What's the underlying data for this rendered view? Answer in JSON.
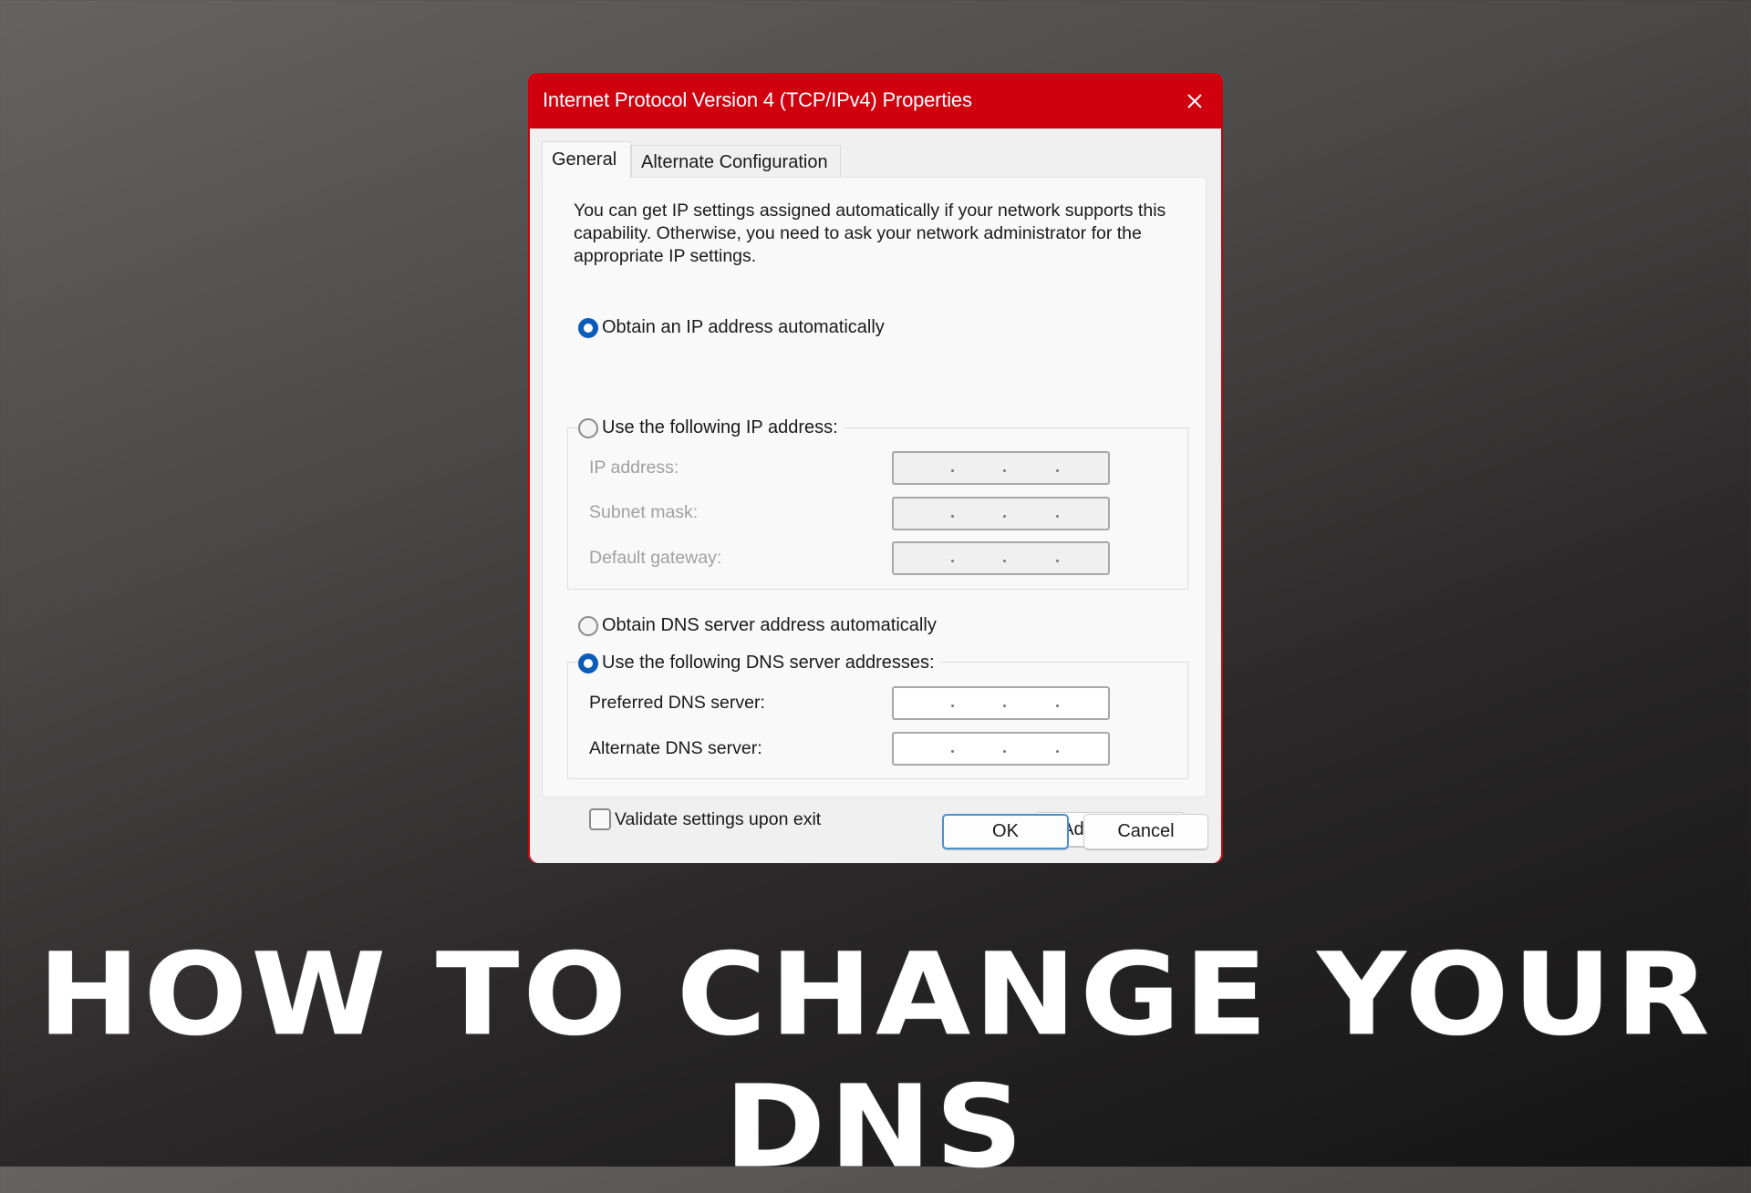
{
  "dialog": {
    "title": "Internet Protocol Version 4 (TCP/IPv4) Properties",
    "close_icon": "close-icon",
    "tabs": [
      {
        "label": "General",
        "selected": true
      },
      {
        "label": "Alternate Configuration",
        "selected": false
      }
    ],
    "intro_text": "You can get IP settings assigned automatically if your network supports this capability. Otherwise, you need to ask your network administrator for the appropriate IP settings.",
    "ip_mode": {
      "options": [
        {
          "label": "Obtain an IP address automatically",
          "checked": true
        },
        {
          "label": "Use the following IP address:",
          "checked": false
        }
      ],
      "fields": [
        {
          "label": "IP address:",
          "value": "",
          "enabled": false
        },
        {
          "label": "Subnet mask:",
          "value": "",
          "enabled": false
        },
        {
          "label": "Default gateway:",
          "value": "",
          "enabled": false
        }
      ]
    },
    "dns_mode": {
      "options": [
        {
          "label": "Obtain DNS server address automatically",
          "checked": false
        },
        {
          "label": "Use the following DNS server addresses:",
          "checked": true
        }
      ],
      "fields": [
        {
          "label": "Preferred DNS server:",
          "value": "",
          "enabled": true
        },
        {
          "label": "Alternate DNS server:",
          "value": "",
          "enabled": true
        }
      ]
    },
    "validate_checkbox": {
      "label": "Validate settings upon exit",
      "checked": false
    },
    "buttons": {
      "advanced": "Advanced...",
      "ok": "OK",
      "cancel": "Cancel"
    },
    "colors": {
      "titlebar": "#d0000e",
      "radio_selected": "#0b5cb8",
      "ok_border": "#4a8fd0"
    }
  },
  "headline": "HOW TO CHANGE YOUR DNS"
}
